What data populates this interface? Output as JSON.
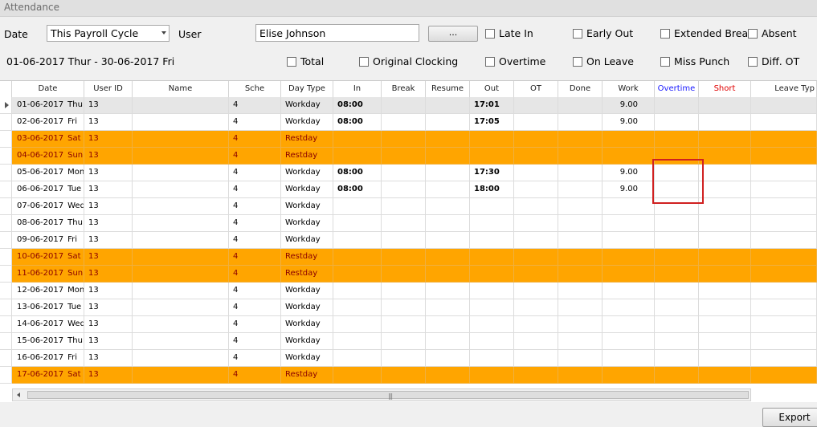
{
  "window": {
    "title": "Attendance"
  },
  "filters": {
    "date_label": "Date",
    "date_value": "This Payroll Cycle",
    "user_label": "User",
    "user_value": "Elise Johnson",
    "browse_label": "...",
    "range_text": "01-06-2017 Thur - 30-06-2017 Fri",
    "checkboxes": {
      "late_in": "Late In",
      "early_out": "Early Out",
      "extended_break": "Extended Break",
      "absent": "Absent",
      "total": "Total",
      "original_clocking": "Original Clocking",
      "overtime": "Overtime",
      "on_leave": "On Leave",
      "miss_punch": "Miss Punch",
      "diff_ot": "Diff. OT"
    }
  },
  "table": {
    "columns": [
      "Date",
      "User ID",
      "Name",
      "Sche",
      "Day Type",
      "In",
      "Break",
      "Resume",
      "Out",
      "OT",
      "Done",
      "Work",
      "Overtime",
      "Short",
      "Leave Typ"
    ],
    "column_colors": {
      "overtime": "#1a1aff",
      "short": "#e00000"
    },
    "rows": [
      {
        "date": "01-06-2017",
        "day": "Thu",
        "user_id": "13",
        "name": "",
        "sche": "4",
        "day_type": "Workday",
        "in": "08:00",
        "break": "",
        "resume": "",
        "out": "17:01",
        "ot": "",
        "done": "",
        "work": "9.00",
        "overtime": "",
        "short": "",
        "leave": "",
        "rest": false,
        "selected": true
      },
      {
        "date": "02-06-2017",
        "day": "Fri",
        "user_id": "13",
        "name": "",
        "sche": "4",
        "day_type": "Workday",
        "in": "08:00",
        "break": "",
        "resume": "",
        "out": "17:05",
        "ot": "",
        "done": "",
        "work": "9.00",
        "overtime": "",
        "short": "",
        "leave": "",
        "rest": false,
        "selected": false
      },
      {
        "date": "03-06-2017",
        "day": "Sat",
        "user_id": "13",
        "name": "",
        "sche": "4",
        "day_type": "Restday",
        "in": "",
        "break": "",
        "resume": "",
        "out": "",
        "ot": "",
        "done": "",
        "work": "",
        "overtime": "",
        "short": "",
        "leave": "",
        "rest": true,
        "selected": false
      },
      {
        "date": "04-06-2017",
        "day": "Sun",
        "user_id": "13",
        "name": "",
        "sche": "4",
        "day_type": "Restday",
        "in": "",
        "break": "",
        "resume": "",
        "out": "",
        "ot": "",
        "done": "",
        "work": "",
        "overtime": "",
        "short": "",
        "leave": "",
        "rest": true,
        "selected": false
      },
      {
        "date": "05-06-2017",
        "day": "Mon",
        "user_id": "13",
        "name": "",
        "sche": "4",
        "day_type": "Workday",
        "in": "08:00",
        "break": "",
        "resume": "",
        "out": "17:30",
        "ot": "",
        "done": "",
        "work": "9.00",
        "overtime": "",
        "short": "",
        "leave": "",
        "rest": false,
        "selected": false
      },
      {
        "date": "06-06-2017",
        "day": "Tue",
        "user_id": "13",
        "name": "",
        "sche": "4",
        "day_type": "Workday",
        "in": "08:00",
        "break": "",
        "resume": "",
        "out": "18:00",
        "ot": "",
        "done": "",
        "work": "9.00",
        "overtime": "",
        "short": "",
        "leave": "",
        "rest": false,
        "selected": false
      },
      {
        "date": "07-06-2017",
        "day": "Wed",
        "user_id": "13",
        "name": "",
        "sche": "4",
        "day_type": "Workday",
        "in": "",
        "break": "",
        "resume": "",
        "out": "",
        "ot": "",
        "done": "",
        "work": "",
        "overtime": "",
        "short": "",
        "leave": "",
        "rest": false,
        "selected": false
      },
      {
        "date": "08-06-2017",
        "day": "Thu",
        "user_id": "13",
        "name": "",
        "sche": "4",
        "day_type": "Workday",
        "in": "",
        "break": "",
        "resume": "",
        "out": "",
        "ot": "",
        "done": "",
        "work": "",
        "overtime": "",
        "short": "",
        "leave": "",
        "rest": false,
        "selected": false
      },
      {
        "date": "09-06-2017",
        "day": "Fri",
        "user_id": "13",
        "name": "",
        "sche": "4",
        "day_type": "Workday",
        "in": "",
        "break": "",
        "resume": "",
        "out": "",
        "ot": "",
        "done": "",
        "work": "",
        "overtime": "",
        "short": "",
        "leave": "",
        "rest": false,
        "selected": false
      },
      {
        "date": "10-06-2017",
        "day": "Sat",
        "user_id": "13",
        "name": "",
        "sche": "4",
        "day_type": "Restday",
        "in": "",
        "break": "",
        "resume": "",
        "out": "",
        "ot": "",
        "done": "",
        "work": "",
        "overtime": "",
        "short": "",
        "leave": "",
        "rest": true,
        "selected": false
      },
      {
        "date": "11-06-2017",
        "day": "Sun",
        "user_id": "13",
        "name": "",
        "sche": "4",
        "day_type": "Restday",
        "in": "",
        "break": "",
        "resume": "",
        "out": "",
        "ot": "",
        "done": "",
        "work": "",
        "overtime": "",
        "short": "",
        "leave": "",
        "rest": true,
        "selected": false
      },
      {
        "date": "12-06-2017",
        "day": "Mon",
        "user_id": "13",
        "name": "",
        "sche": "4",
        "day_type": "Workday",
        "in": "",
        "break": "",
        "resume": "",
        "out": "",
        "ot": "",
        "done": "",
        "work": "",
        "overtime": "",
        "short": "",
        "leave": "",
        "rest": false,
        "selected": false
      },
      {
        "date": "13-06-2017",
        "day": "Tue",
        "user_id": "13",
        "name": "",
        "sche": "4",
        "day_type": "Workday",
        "in": "",
        "break": "",
        "resume": "",
        "out": "",
        "ot": "",
        "done": "",
        "work": "",
        "overtime": "",
        "short": "",
        "leave": "",
        "rest": false,
        "selected": false
      },
      {
        "date": "14-06-2017",
        "day": "Wed",
        "user_id": "13",
        "name": "",
        "sche": "4",
        "day_type": "Workday",
        "in": "",
        "break": "",
        "resume": "",
        "out": "",
        "ot": "",
        "done": "",
        "work": "",
        "overtime": "",
        "short": "",
        "leave": "",
        "rest": false,
        "selected": false
      },
      {
        "date": "15-06-2017",
        "day": "Thu",
        "user_id": "13",
        "name": "",
        "sche": "4",
        "day_type": "Workday",
        "in": "",
        "break": "",
        "resume": "",
        "out": "",
        "ot": "",
        "done": "",
        "work": "",
        "overtime": "",
        "short": "",
        "leave": "",
        "rest": false,
        "selected": false
      },
      {
        "date": "16-06-2017",
        "day": "Fri",
        "user_id": "13",
        "name": "",
        "sche": "4",
        "day_type": "Workday",
        "in": "",
        "break": "",
        "resume": "",
        "out": "",
        "ot": "",
        "done": "",
        "work": "",
        "overtime": "",
        "short": "",
        "leave": "",
        "rest": false,
        "selected": false
      },
      {
        "date": "17-06-2017",
        "day": "Sat",
        "user_id": "13",
        "name": "",
        "sche": "4",
        "day_type": "Restday",
        "in": "",
        "break": "",
        "resume": "",
        "out": "",
        "ot": "",
        "done": "",
        "work": "",
        "overtime": "",
        "short": "",
        "leave": "",
        "rest": true,
        "selected": false
      }
    ]
  },
  "footer": {
    "export_label": "Export"
  },
  "colors": {
    "restday_row": "#ffa500",
    "restday_text": "#8b0000",
    "highlight_box": "#d02020"
  }
}
